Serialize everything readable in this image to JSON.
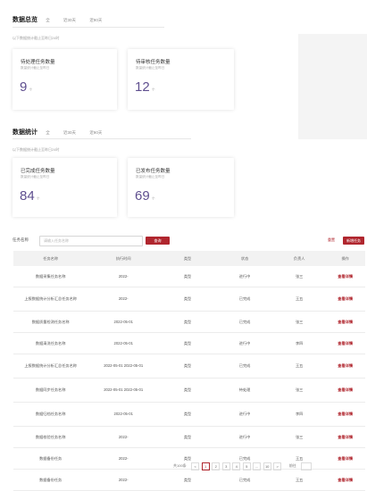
{
  "section1": {
    "title": "数据总览",
    "tabs": [
      "全",
      "近30天",
      "近90天"
    ],
    "hint": "以下数据统计截止至昨日24时",
    "cards": [
      {
        "title": "待处理任务数量",
        "sub": "数量统计截止至昨日",
        "value": "9",
        "unit": "个"
      },
      {
        "title": "待审核任务数量",
        "sub": "数量统计截止至昨日",
        "value": "12",
        "unit": "个"
      }
    ]
  },
  "section2": {
    "title": "数据统计",
    "tabs": [
      "全",
      "近30天",
      "近90天"
    ],
    "hint": "以下数据统计截止至昨日24时",
    "cards": [
      {
        "title": "已完成任务数量",
        "sub": "数量统计截止至昨日",
        "value": "84",
        "unit": "个"
      },
      {
        "title": "已发布任务数量",
        "sub": "数量统计截止至昨日",
        "value": "69",
        "unit": "个"
      }
    ]
  },
  "filter": {
    "label": "任务名称",
    "placeholder": "请输入任务名称",
    "search_label": "查询",
    "reset_label": "重置",
    "add_label": "新增任务"
  },
  "table": {
    "headers": [
      "任务名称",
      "执行时间",
      "类型",
      "状态",
      "负责人",
      "操作"
    ],
    "rows": [
      {
        "name": "数据采集任务名称",
        "time": "2022-",
        "type": "类型",
        "status": "进行中",
        "owner": "张三",
        "op": "查看详情"
      },
      {
        "name": "上报数据统计分析汇总任务名称",
        "time": "2022-",
        "type": "类型",
        "status": "已完成",
        "owner": "王五",
        "op": "查看详情"
      },
      {
        "name": "数据质量检测任务名称",
        "time": "2022-05-01",
        "type": "类型",
        "status": "已完成",
        "owner": "张三",
        "op": "查看详情"
      },
      {
        "name": "数据清洗任务名称",
        "time": "2022-05-01",
        "type": "类型",
        "status": "进行中",
        "owner": "李四",
        "op": "查看详情"
      },
      {
        "name": "上报数据统计分析汇总任务名称",
        "time": "2022-05-01 2022-05-01",
        "type": "类型",
        "status": "已完成",
        "owner": "王五",
        "op": "查看详情"
      },
      {
        "name": "数据同步任务名称",
        "time": "2022-05-01 2022-05-01",
        "type": "类型",
        "status": "待处理",
        "owner": "张三",
        "op": "查看详情"
      },
      {
        "name": "数据归档任务名称",
        "time": "2022-05-01",
        "type": "类型",
        "status": "进行中",
        "owner": "李四",
        "op": "查看详情"
      },
      {
        "name": "数据校验任务名称",
        "time": "2022-",
        "type": "类型",
        "status": "进行中",
        "owner": "张三",
        "op": "查看详情"
      },
      {
        "name": "数据备份任务",
        "time": "2022-",
        "type": "类型",
        "status": "已完成",
        "owner": "王五",
        "op": "查看详情"
      },
      {
        "name": "数据备份任务",
        "time": "2022-",
        "type": "类型",
        "status": "已完成",
        "owner": "王五",
        "op": "查看详情"
      }
    ]
  },
  "pager": {
    "total_label": "共100条",
    "pages": [
      "<",
      "1",
      "2",
      "3",
      "4",
      "5",
      "...",
      "10",
      ">"
    ],
    "active_page": "1",
    "jump_label": "前往"
  },
  "colors": {
    "accent": "#b0262e",
    "value": "#5f4f8f"
  }
}
